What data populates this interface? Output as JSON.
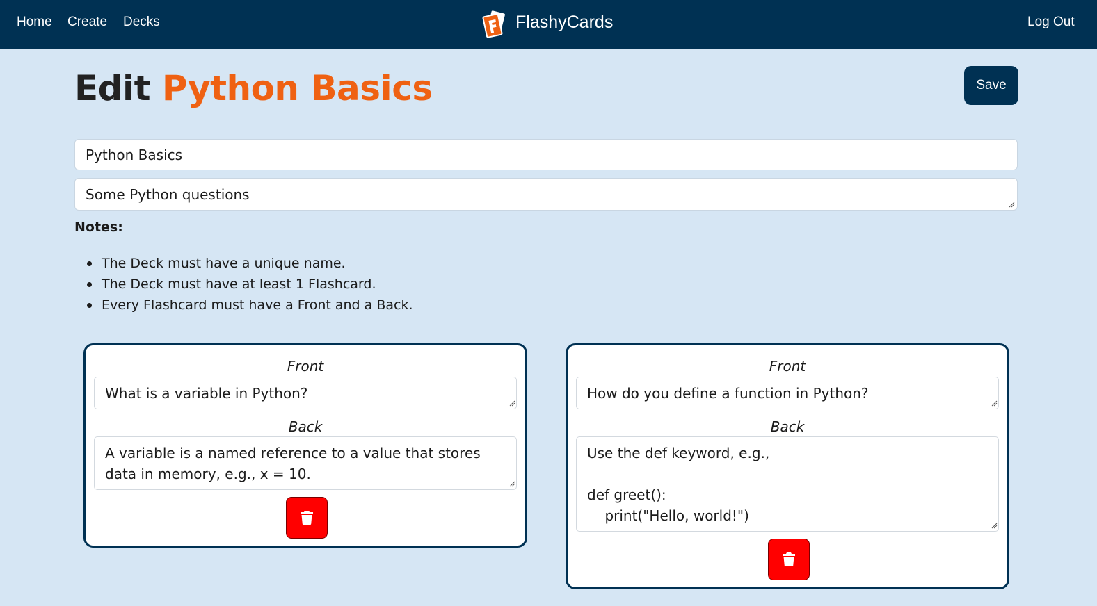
{
  "nav": {
    "links": [
      "Home",
      "Create",
      "Decks"
    ],
    "brand": "FlashyCards",
    "logout": "Log Out"
  },
  "header": {
    "title_prefix": "Edit",
    "title_deck": "Python Basics",
    "save_label": "Save"
  },
  "deck": {
    "name": "Python Basics",
    "description": "Some Python questions"
  },
  "notes": {
    "label": "Notes:",
    "items": [
      "The Deck must have a unique name.",
      "The Deck must have at least 1 Flashcard.",
      "Every Flashcard must have a Front and a Back."
    ]
  },
  "cards": [
    {
      "front_label": "Front",
      "front": "What is a variable in Python?",
      "back_label": "Back",
      "back": "A variable is a named reference to a value that stores\ndata in memory, e.g., x = 10."
    },
    {
      "front_label": "Front",
      "front": "How do you define a function in Python?",
      "back_label": "Back",
      "back": "Use the def keyword, e.g.,\n\ndef greet():\n    print(\"Hello, world!\")"
    }
  ],
  "colors": {
    "navy": "#003153",
    "accent": "#ef6112",
    "background": "#d6e6f4",
    "delete": "#ff0000"
  },
  "icons": {
    "delete": "trash-icon",
    "logo": "flashcards-logo-icon"
  }
}
